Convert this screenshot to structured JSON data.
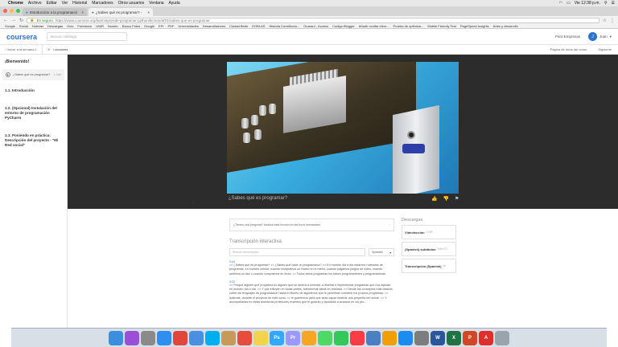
{
  "os_menubar": {
    "apple": "",
    "items": [
      "Chrome",
      "Archivo",
      "Editar",
      "Ver",
      "Historial",
      "Marcadores",
      "Otros usuarios",
      "Ventana",
      "Ayuda"
    ],
    "clock": "Vie 12:38 p.m."
  },
  "browser": {
    "tabs": [
      {
        "label": "Introducción a la programació",
        "active": false
      },
      {
        "label": "¿Sabes qué es programar? - ",
        "active": true
      }
    ],
    "url_secure_label": "Es seguro",
    "url": "https://www.coursera.org/learn/aprende-programar-python/lecture/alTE/sabes-que-es-programar",
    "bookmarks": [
      "Google",
      "Social",
      "Noticias",
      "Descargas",
      "Ocio",
      "Freelance",
      "UNIR",
      "Noseto",
      "Banco Fotos",
      "Google",
      "EPI",
      "PDF",
      "Universidades",
      "Desarrolladores",
      "Ciudad Bebé",
      "DOBLAS",
      "Historia Constitucio...",
      "Guaraní - Acceso",
      "Código Blogger",
      "Añadir ocultar elem...",
      "Prueba de optimiza...",
      "Mobile Friendly Test",
      "PageSpeed Insights",
      "Artes y desarrollo"
    ]
  },
  "header": {
    "logo": "coursera",
    "search_placeholder": "Buscar catálogo",
    "enterprise_link": "Para Empresas",
    "user_initial": "J",
    "user_name": "Juan"
  },
  "subbar": {
    "back_label": "Volver a la semana 1",
    "lessons_label": "Lecciones",
    "course_home": "Página de inicio del curso",
    "next_label": "Siguiente"
  },
  "sidebar": {
    "section_title": "¡Bienvenido!",
    "current_lesson": {
      "label": "¿Sabes qué es programar?",
      "duration": "1 min"
    },
    "items": [
      "1.1. Introducción",
      "1.2. (Opcional) Instalación del entorno de programación PyCharm",
      "1.3. Poniendo en práctica: Descripción del proyecto - \"Mi Red social\""
    ]
  },
  "video": {
    "title": "¿Sabes qué es programar?"
  },
  "question_box": "¿Tienes una pregunta? Analiza esta lección en los foros semanales.",
  "transcript": {
    "title": "Transcripción interactiva",
    "search_placeholder": "Buscar transcripción",
    "language": "Spanish",
    "paragraphs": [
      {
        "time": "0:04",
        "text": ">> ¿Sabes qué es programar? >> ¿Sabes qué hace un programador? >> En nuestro día a día estamos rodeados de programas, en nuestro celular, cuando compramos un boleto en el metro, cuando pagamos juegos de video, cuando pedimos un taxi o cuando compramos en línea. >> Todos estos programas los hacen programadores y programadoras."
      },
      {
        "time": "0:22",
        "text": ">> Porque alguien que programa es alguien que se dedica a inventar, a diseñar e implementar programas que nos ayudan en nuestro día a día. >> Y que influyen en todas partes, transformar ideas en realidad. >> Desde los conceptos más básicos sobre los lenguajes de programación hasta el diseño de algoritmos que te permitirán construir tus propios programas. >> Además, durante el proyecto de este curso >> te guiaremos para que seas capaz destruir una pequeña red social. >> Y acompañarlas en estas aventuras profesores expertos que te guiarán y ayudarán a avanzar en los pro..."
      }
    ]
  },
  "downloads": {
    "title": "Descargas",
    "items": [
      {
        "label": "Videolección",
        "meta": "4 MB"
      },
      {
        "label": "(Spanish) subtítulos",
        "meta": "WebVTT"
      },
      {
        "label": "Transcripción (Spanish)",
        "meta": "txt"
      }
    ]
  },
  "dock_icons": [
    "finder-icon",
    "siri-icon",
    "launchpad-icon",
    "safari-icon",
    "chrome-icon",
    "mail-icon",
    "skype-icon",
    "contacts-icon",
    "calendar-icon",
    "notes-icon",
    "photoshop-icon",
    "premiere-icon",
    "photos-icon",
    "messages-icon",
    "facetime-icon",
    "itunes-icon",
    "preview-icon",
    "ibooks-icon",
    "app-store-icon",
    "system-preferences-icon",
    "word-icon",
    "excel-icon",
    "powerpoint-icon",
    "acrobat-icon",
    "trash-icon"
  ],
  "colors": {
    "brand": "#2a73cc",
    "video_bg": "#2c2c2c"
  }
}
